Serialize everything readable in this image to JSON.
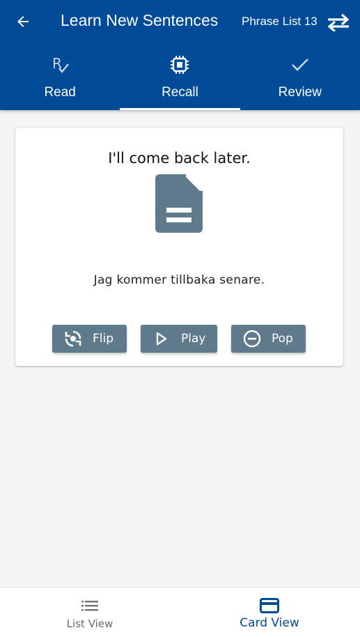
{
  "header": {
    "title": "Learn New Sentences",
    "list_name": "Phrase List 13",
    "background_color": "#004b97"
  },
  "tabs": [
    {
      "label": "Read",
      "icon": "prescription-icon",
      "active": false
    },
    {
      "label": "Recall",
      "icon": "chip-icon",
      "active": true
    },
    {
      "label": "Review",
      "icon": "checkmark-icon",
      "active": false
    }
  ],
  "card": {
    "sentence": "I'll come back later.",
    "icon": "document-icon",
    "translation": "Jag kommer tillbaka senare."
  },
  "actions": {
    "flip_label": "Flip",
    "play_label": "Play",
    "pop_label": "Pop",
    "button_color": "#5f7a8a"
  },
  "bottom_nav": {
    "list_view_label": "List View",
    "card_view_label": "Card View",
    "active": "Card View"
  }
}
